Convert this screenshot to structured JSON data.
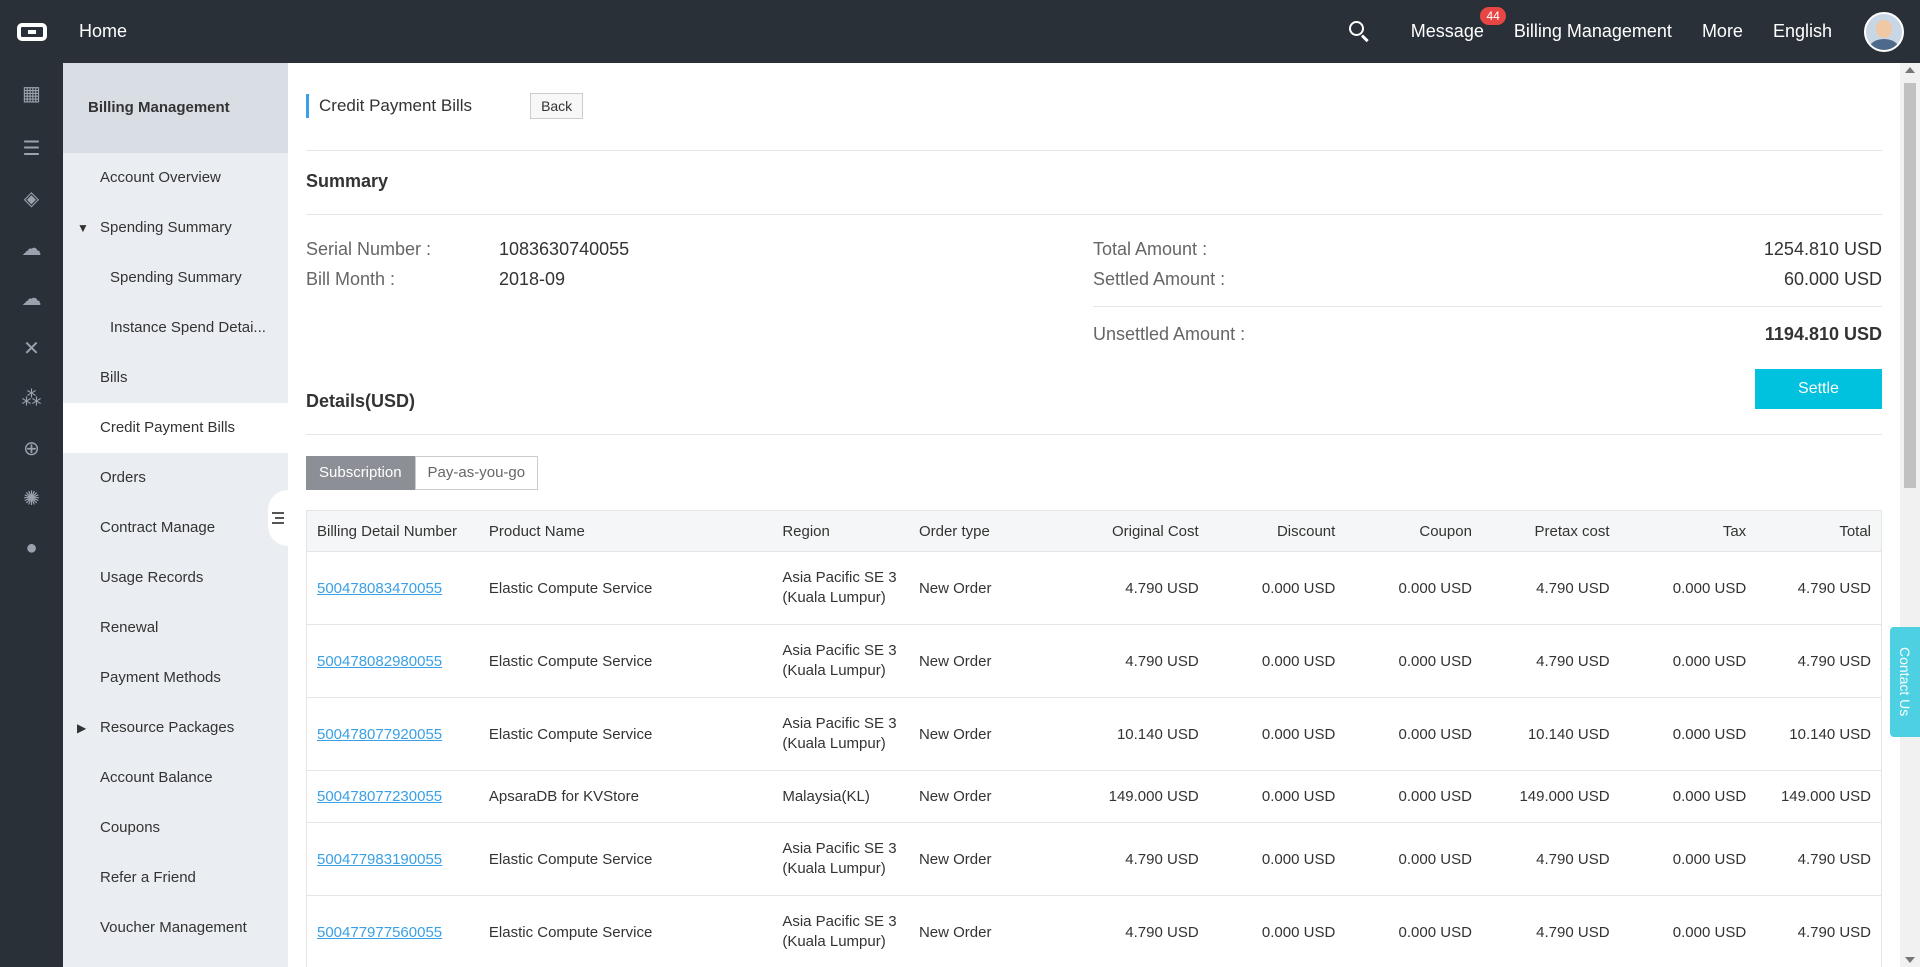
{
  "topbar": {
    "home": "Home",
    "message": "Message",
    "message_badge": "44",
    "billing": "Billing Management",
    "more": "More",
    "language": "English"
  },
  "iconbar": [
    "grid-icon",
    "server-icon",
    "chip-icon",
    "cloud-icon",
    "cloud-upload-icon",
    "network-icon",
    "cluster-icon",
    "globe-icon",
    "bug-icon",
    "circle-icon"
  ],
  "sidebar": {
    "title": "Billing Management",
    "items": [
      {
        "label": "Account Overview"
      },
      {
        "label": "Spending Summary"
      },
      {
        "label": "Spending Summary"
      },
      {
        "label": "Instance Spend Detai..."
      },
      {
        "label": "Bills"
      },
      {
        "label": "Credit Payment Bills"
      },
      {
        "label": "Orders"
      },
      {
        "label": "Contract Manage"
      },
      {
        "label": "Usage Records"
      },
      {
        "label": "Renewal"
      },
      {
        "label": "Payment Methods"
      },
      {
        "label": "Resource Packages"
      },
      {
        "label": "Account Balance"
      },
      {
        "label": "Coupons"
      },
      {
        "label": "Refer a Friend"
      },
      {
        "label": "Voucher Management"
      }
    ]
  },
  "page": {
    "title": "Credit Payment Bills",
    "back": "Back",
    "summary_title": "Summary",
    "serial_label": "Serial Number :",
    "serial_value": "1083630740055",
    "month_label": "Bill Month :",
    "month_value": "2018-09",
    "total_label": "Total Amount :",
    "total_value": "1254.810 USD",
    "settled_label": "Settled Amount :",
    "settled_value": "60.000 USD",
    "unsettled_label": "Unsettled Amount :",
    "unsettled_value": "1194.810 USD",
    "settle": "Settle",
    "details_title": "Details(USD)",
    "tab_subscription": "Subscription",
    "tab_payg": "Pay-as-you-go",
    "contact": "Contact Us"
  },
  "table": {
    "headers": [
      "Billing Detail Number",
      "Product Name",
      "Region",
      "Order type",
      "Original Cost",
      "Discount",
      "Coupon",
      "Pretax cost",
      "Tax",
      "Total"
    ],
    "rows": [
      {
        "id": "500478083470055",
        "product": "Elastic Compute Service",
        "region1": "Asia Pacific SE 3",
        "region2": "(Kuala Lumpur)",
        "type": "New Order",
        "orig": "4.790 USD",
        "disc": "0.000 USD",
        "coupon": "0.000 USD",
        "pretax": "4.790 USD",
        "tax": "0.000 USD",
        "total": "4.790 USD"
      },
      {
        "id": "500478082980055",
        "product": "Elastic Compute Service",
        "region1": "Asia Pacific SE 3",
        "region2": "(Kuala Lumpur)",
        "type": "New Order",
        "orig": "4.790 USD",
        "disc": "0.000 USD",
        "coupon": "0.000 USD",
        "pretax": "4.790 USD",
        "tax": "0.000 USD",
        "total": "4.790 USD"
      },
      {
        "id": "500478077920055",
        "product": "Elastic Compute Service",
        "region1": "Asia Pacific SE 3",
        "region2": "(Kuala Lumpur)",
        "type": "New Order",
        "orig": "10.140 USD",
        "disc": "0.000 USD",
        "coupon": "0.000 USD",
        "pretax": "10.140 USD",
        "tax": "0.000 USD",
        "total": "10.140 USD"
      },
      {
        "id": "500478077230055",
        "product": "ApsaraDB for KVStore",
        "region1": "Malaysia(KL)",
        "region2": "",
        "type": "New Order",
        "orig": "149.000 USD",
        "disc": "0.000 USD",
        "coupon": "0.000 USD",
        "pretax": "149.000 USD",
        "tax": "0.000 USD",
        "total": "149.000 USD"
      },
      {
        "id": "500477983190055",
        "product": "Elastic Compute Service",
        "region1": "Asia Pacific SE 3",
        "region2": "(Kuala Lumpur)",
        "type": "New Order",
        "orig": "4.790 USD",
        "disc": "0.000 USD",
        "coupon": "0.000 USD",
        "pretax": "4.790 USD",
        "tax": "0.000 USD",
        "total": "4.790 USD"
      },
      {
        "id": "500477977560055",
        "product": "Elastic Compute Service",
        "region1": "Asia Pacific SE 3",
        "region2": "(Kuala Lumpur)",
        "type": "New Order",
        "orig": "4.790 USD",
        "disc": "0.000 USD",
        "coupon": "0.000 USD",
        "pretax": "4.790 USD",
        "tax": "0.000 USD",
        "total": "4.790 USD"
      }
    ]
  }
}
